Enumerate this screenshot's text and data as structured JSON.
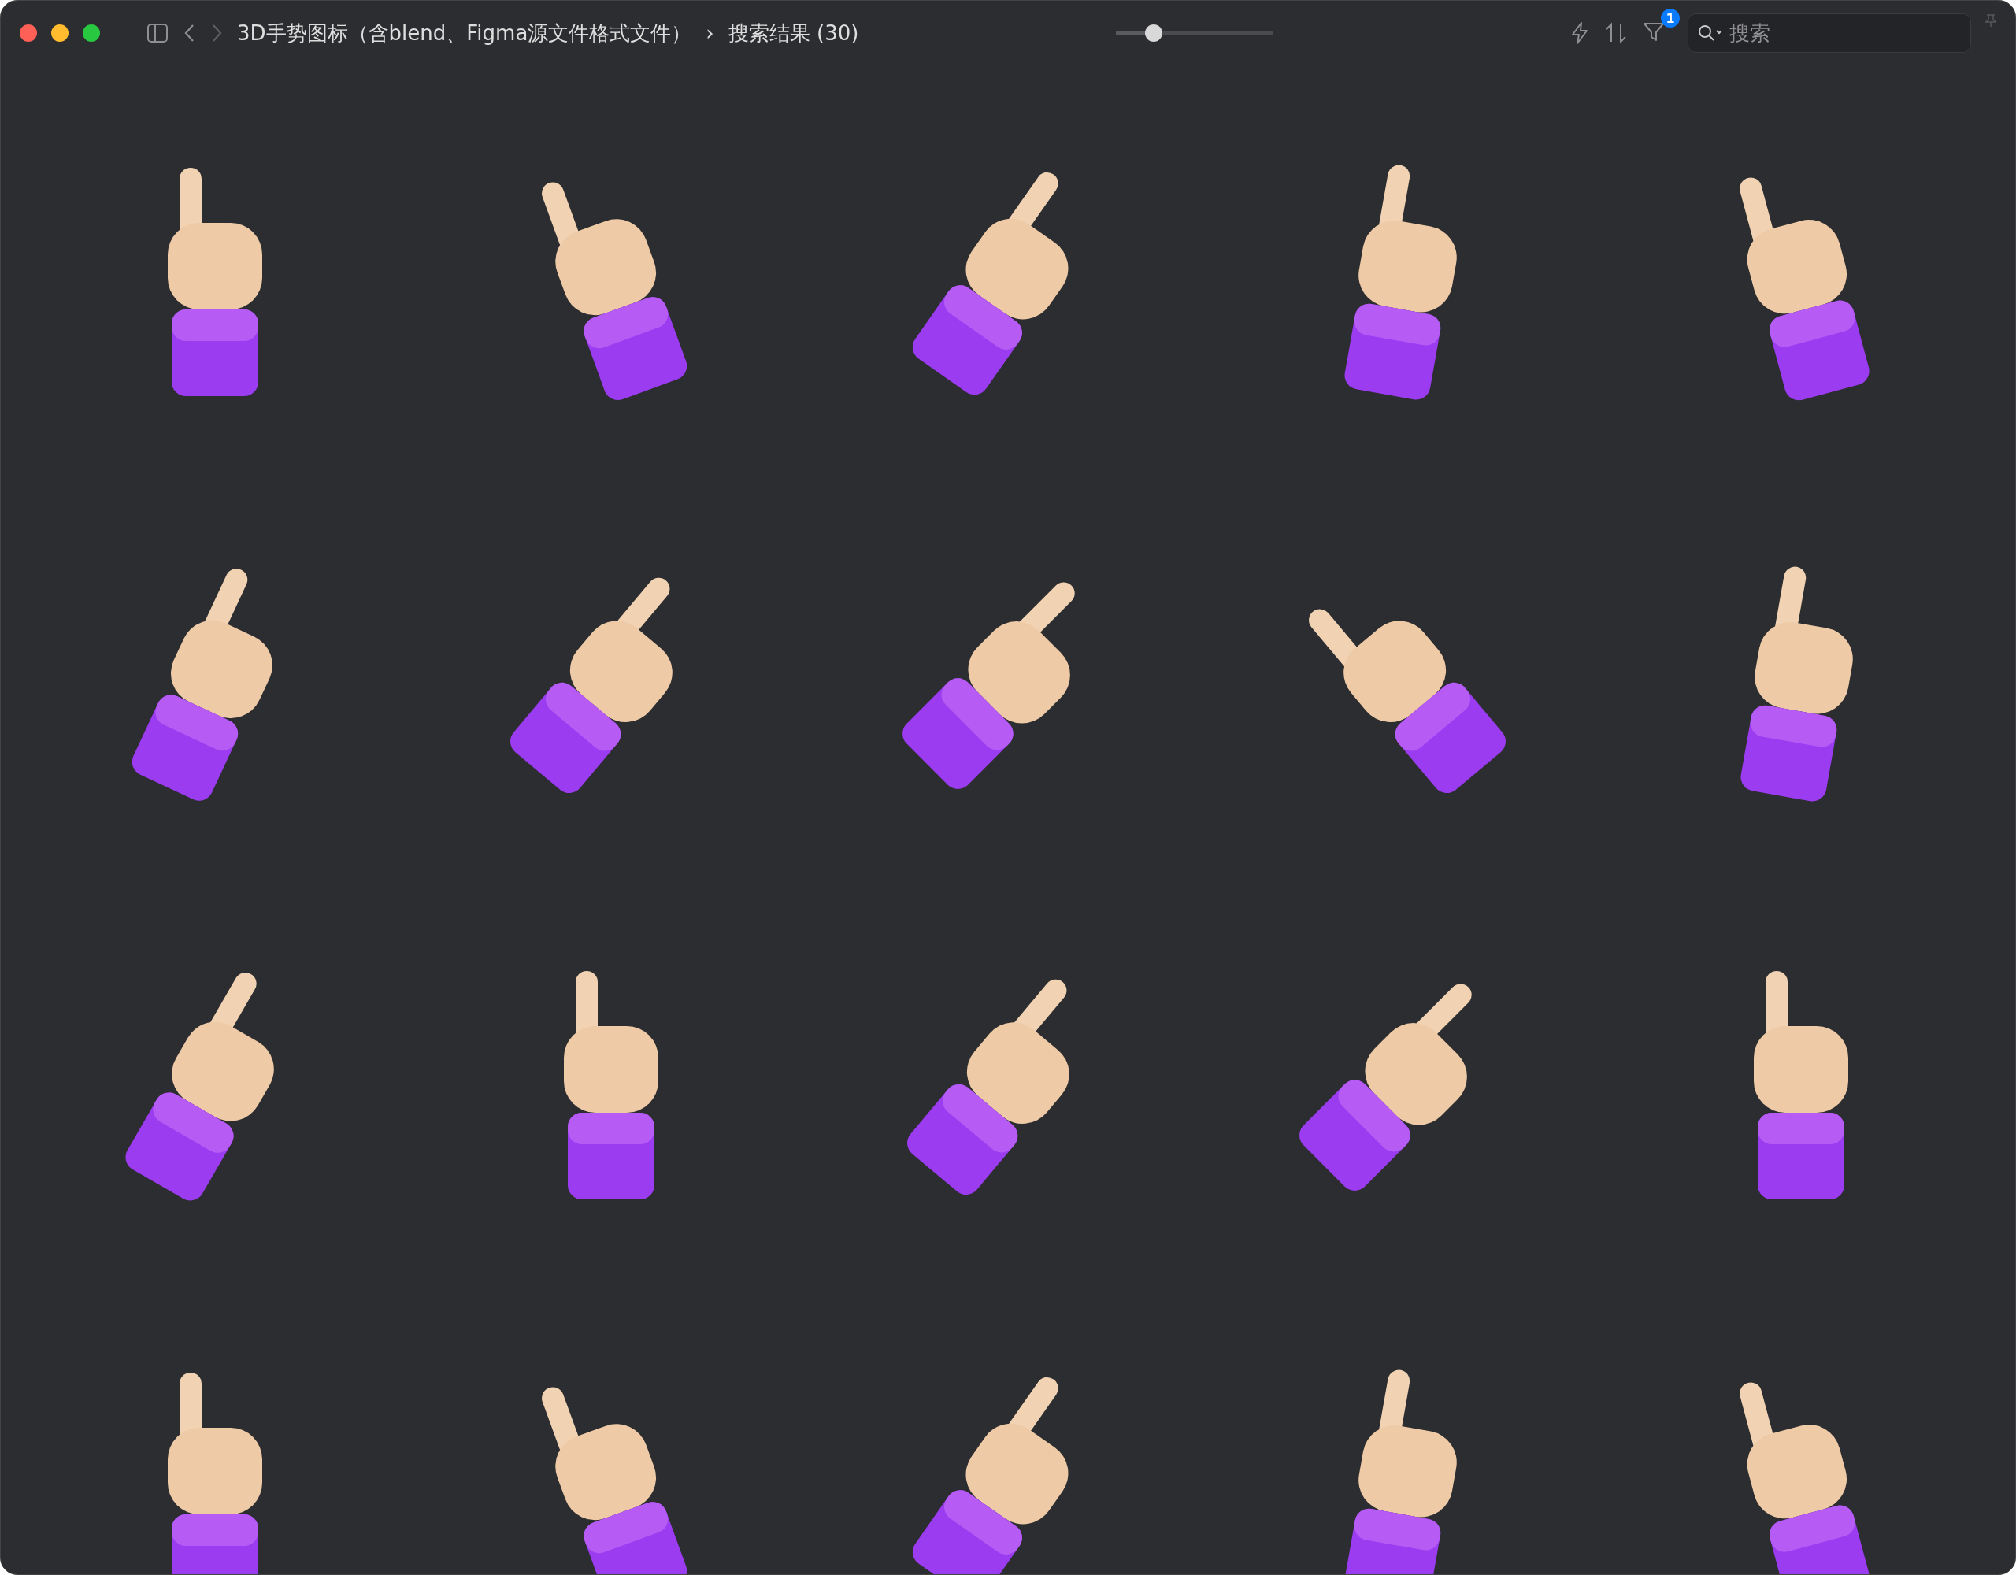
{
  "window": {
    "title": "3D手势图标（含blend、Figma源文件格式文件）"
  },
  "breadcrumb": {
    "separator": "›",
    "current": "搜索结果 (30)"
  },
  "zoom_slider": {
    "level": 0.24
  },
  "filter": {
    "badge": "1"
  },
  "search": {
    "placeholder": "搜索"
  },
  "thumbnails": [
    {
      "kind": "hand"
    },
    {
      "kind": "hand"
    },
    {
      "kind": "hand"
    },
    {
      "kind": "hand"
    },
    {
      "kind": "hand"
    },
    {
      "kind": "hand"
    },
    {
      "kind": "hand"
    },
    {
      "kind": "hand"
    },
    {
      "kind": "hand"
    },
    {
      "kind": "hand"
    },
    {
      "kind": "hand"
    },
    {
      "kind": "hand"
    },
    {
      "kind": "hand"
    },
    {
      "kind": "hand"
    },
    {
      "kind": "hand"
    },
    {
      "kind": "hand"
    },
    {
      "kind": "hand"
    },
    {
      "kind": "hand"
    },
    {
      "kind": "hand"
    },
    {
      "kind": "hand"
    }
  ]
}
